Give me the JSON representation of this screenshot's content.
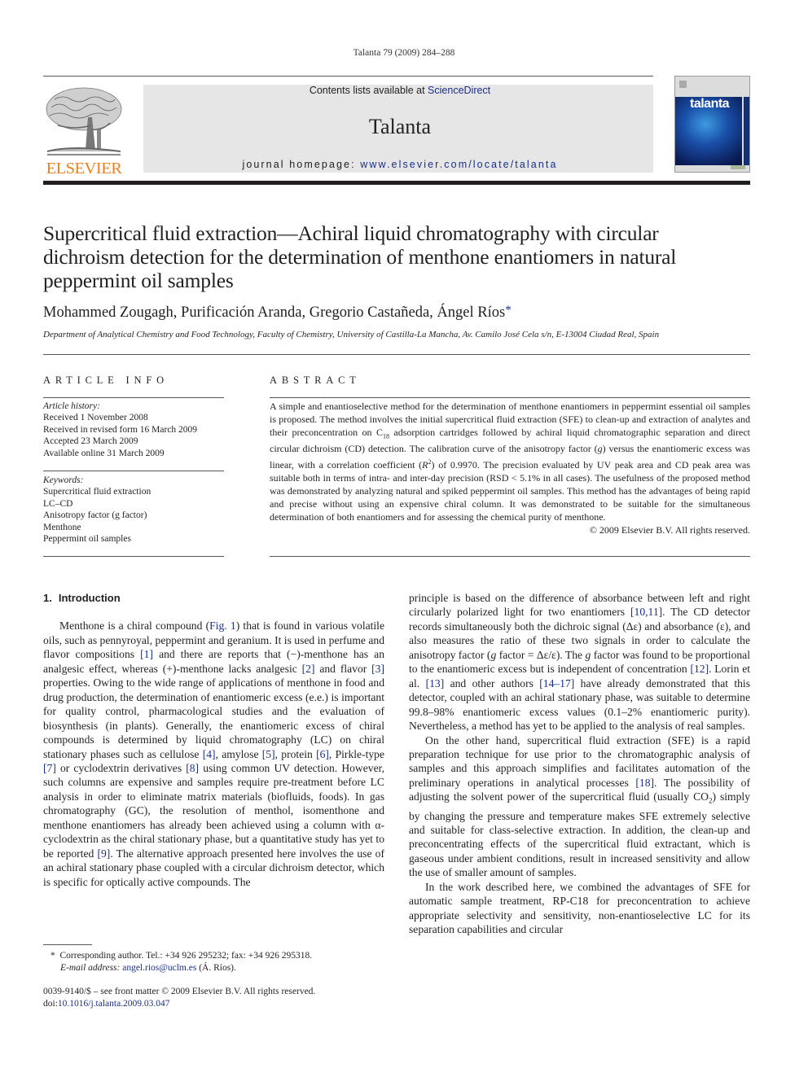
{
  "header": {
    "citation": "Talanta 79 (2009) 284–288",
    "contents_prefix": "Contents lists available at ",
    "contents_link": "ScienceDirect",
    "journal_name": "Talanta",
    "homepage_prefix": "journal homepage: ",
    "homepage_link": "www.elsevier.com/locate/talanta",
    "publisher_logo_text": "ELSEVIER",
    "cover_title": "talanta"
  },
  "colors": {
    "elsevier_orange": "#f07f1a",
    "link_blue": "#1a2f8a",
    "banner_gray": "#e6e6e6"
  },
  "article": {
    "title": "Supercritical fluid extraction—Achiral liquid chromatography with circular dichroism detection for the determination of menthone enantiomers in natural peppermint oil samples",
    "authors": "Mohammed Zougagh, Purificación Aranda, Gregorio Castañeda, Ángel Ríos",
    "corresponding_mark": "*",
    "affiliation": "Department of Analytical Chemistry and Food Technology, Faculty of Chemistry, University of Castilla-La Mancha, Av. Camilo José Cela s/n, E-13004 Ciudad Real, Spain"
  },
  "article_info": {
    "heading": "ARTICLE INFO",
    "history_label": "Article history:",
    "history": [
      "Received 1 November 2008",
      "Received in revised form 16 March 2009",
      "Accepted 23 March 2009",
      "Available online 31 March 2009"
    ],
    "keywords_label": "Keywords:",
    "keywords": [
      "Supercritical fluid extraction",
      "LC–CD",
      "Anisotropy factor (g factor)",
      "Menthone",
      "Peppermint oil samples"
    ]
  },
  "abstract": {
    "heading": "ABSTRACT",
    "text_1": "A simple and enantioselective method for the determination of menthone enantiomers in peppermint essential oil samples is proposed. The method involves the initial supercritical fluid extraction (SFE) to clean-up and extraction of analytes and their preconcentration on C",
    "sub_18": "18",
    "text_2": " adsorption cartridges followed by achiral liquid chromatographic separation and direct circular dichroism (CD) detection. The calibration curve of the anisotropy factor (",
    "g": "g",
    "text_3": ") versus the enantiomeric excess was linear, with a correlation coefficient (",
    "r": "R",
    "sup_2": "2",
    "text_4": ") of 0.9970. The precision evaluated by UV peak area and CD peak area was suitable both in terms of intra- and inter-day precision (RSD < 5.1% in all cases). The usefulness of the proposed method was demonstrated by analyzing natural and spiked peppermint oil samples. This method has the advantages of being rapid and precise without using an expensive chiral column. It was demonstrated to be suitable for the simultaneous determination of both enantiomers and for assessing the chemical purity of menthone.",
    "copyright": "© 2009 Elsevier B.V. All rights reserved."
  },
  "intro": {
    "number": "1.",
    "title": "Introduction",
    "p1": [
      "Menthone is a chiral compound (",
      "Fig. 1",
      ") that is found in various volatile oils, such as pennyroyal, peppermint and geranium. It is used in perfume and flavor compositions ",
      "[1]",
      " and there are reports that (−)-menthone has an analgesic effect, whereas (+)-menthone lacks analgesic ",
      "[2]",
      " and flavor ",
      "[3]",
      " properties. Owing to the wide range of applications of menthone in food and drug production, the determination of enantiomeric excess (e.e.) is important for quality control, pharmacological studies and the evaluation of biosynthesis (in plants). Generally, the enantiomeric excess of chiral compounds is determined by liquid chromatography (LC) on chiral stationary phases such as cellulose ",
      "[4]",
      ", amylose ",
      "[5]",
      ", protein ",
      "[6]",
      ", Pirkle-type ",
      "[7]",
      " or cyclodextrin derivatives ",
      "[8]",
      " using common UV detection. However, such columns are expensive and samples require pre-treatment before LC analysis in order to eliminate matrix materials (biofluids, foods). In gas chromatography (GC), the resolution of menthol, isomenthone and menthone enantiomers has already been achieved using a column with α-cyclodextrin as the chiral stationary phase, but a quantitative study has yet to be reported ",
      "[9]",
      ". The alternative approach presented here involves the use of an achiral stationary phase coupled with a circular dichroism detector, which is specific for optically active compounds. The principle is based on the difference of absorbance between left and right circularly polarized light for two enantiomers ",
      "[10,11]",
      ". The CD detector records simultaneously both the dichroic signal (Δε) and absorbance (ε), and also measures the ratio of these two signals in order to calculate the anisotropy factor (",
      "g",
      " factor = Δε/ε). The ",
      "g",
      " factor was found to be proportional to the enantiomeric excess but is independent of concentration ",
      "[12]",
      ". Lorin et al. ",
      "[13]",
      " and other authors ",
      "[14–17]",
      " have already demonstrated that this detector, coupled with an achiral stationary phase, was suitable to determine 99.8–98% enantiomeric excess values (0.1–2% enantiomeric purity). Nevertheless, a method has yet to be applied to the analysis of real samples."
    ],
    "p2_a": "On the other hand, supercritical fluid extraction (SFE) is a rapid preparation technique for use prior to the chromatographic analysis of samples and this approach simplifies and facilitates automation of the preliminary operations in analytical processes ",
    "p2_ref": "[18]",
    "p2_b": ". The possibility of adjusting the solvent power of the supercritical fluid (usually CO",
    "p2_sub": "2",
    "p2_c": ") simply by changing the pressure and temperature makes SFE extremely selective and suitable for class-selective extraction. In addition, the clean-up and preconcentrating effects of the supercritical fluid extractant, which is gaseous under ambient conditions, result in increased sensitivity and allow the use of smaller amount of samples.",
    "p3": "In the work described here, we combined the advantages of SFE for automatic sample treatment, RP-C18 for preconcentration to achieve appropriate selectivity and sensitivity, non-enantioselective LC for its separation capabilities and circular"
  },
  "footnote": {
    "mark": "*",
    "text": "Corresponding author. Tel.: +34 926 295232; fax: +34 926 295318.",
    "email_label": "E-mail address:",
    "email": "angel.rios@uclm.es",
    "email_suffix": " (Á. Ríos)."
  },
  "front_matter": {
    "issn_line": "0039-9140/$ – see front matter © 2009 Elsevier B.V. All rights reserved.",
    "doi_prefix": "doi:",
    "doi": "10.1016/j.talanta.2009.03.047"
  }
}
